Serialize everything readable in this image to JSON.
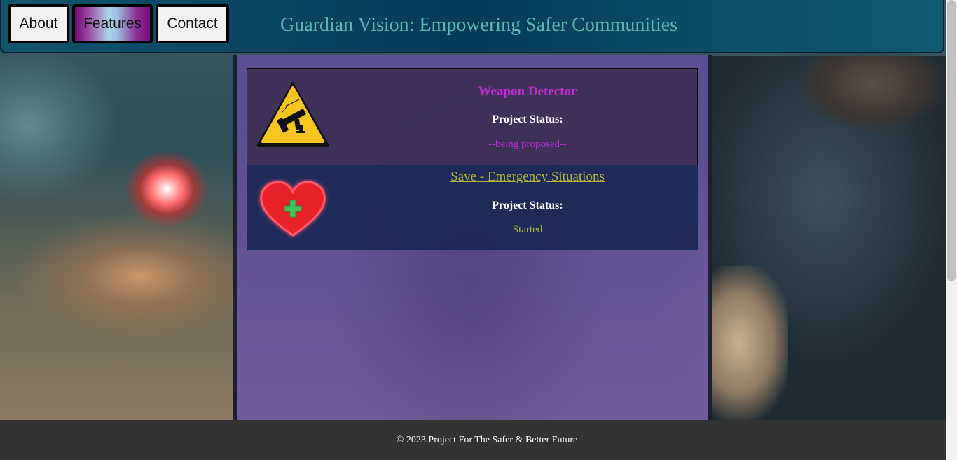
{
  "nav": {
    "items": [
      {
        "label": "About",
        "active": false
      },
      {
        "label": "Features",
        "active": true
      },
      {
        "label": "Contact",
        "active": false
      }
    ]
  },
  "header": {
    "title": "Guardian Vision: Empowering Safer Communities"
  },
  "projects": [
    {
      "icon": "weapon-warning-icon",
      "title": "Weapon Detector",
      "status_label": "Project Status:",
      "status_value": "--being proposed--",
      "color": "#c02bd6"
    },
    {
      "icon": "heart-medical-icon",
      "title": "Save - Emergency Situations",
      "status_label": "Project Status:",
      "status_value": "Started",
      "color": "#b5b63a"
    }
  ],
  "footer": {
    "text": "© 2023 Project For The Safer & Better Future"
  },
  "colors": {
    "header_title": "#5bb6b3",
    "footer_bg": "#333333",
    "header_bg": "#0a4662"
  }
}
